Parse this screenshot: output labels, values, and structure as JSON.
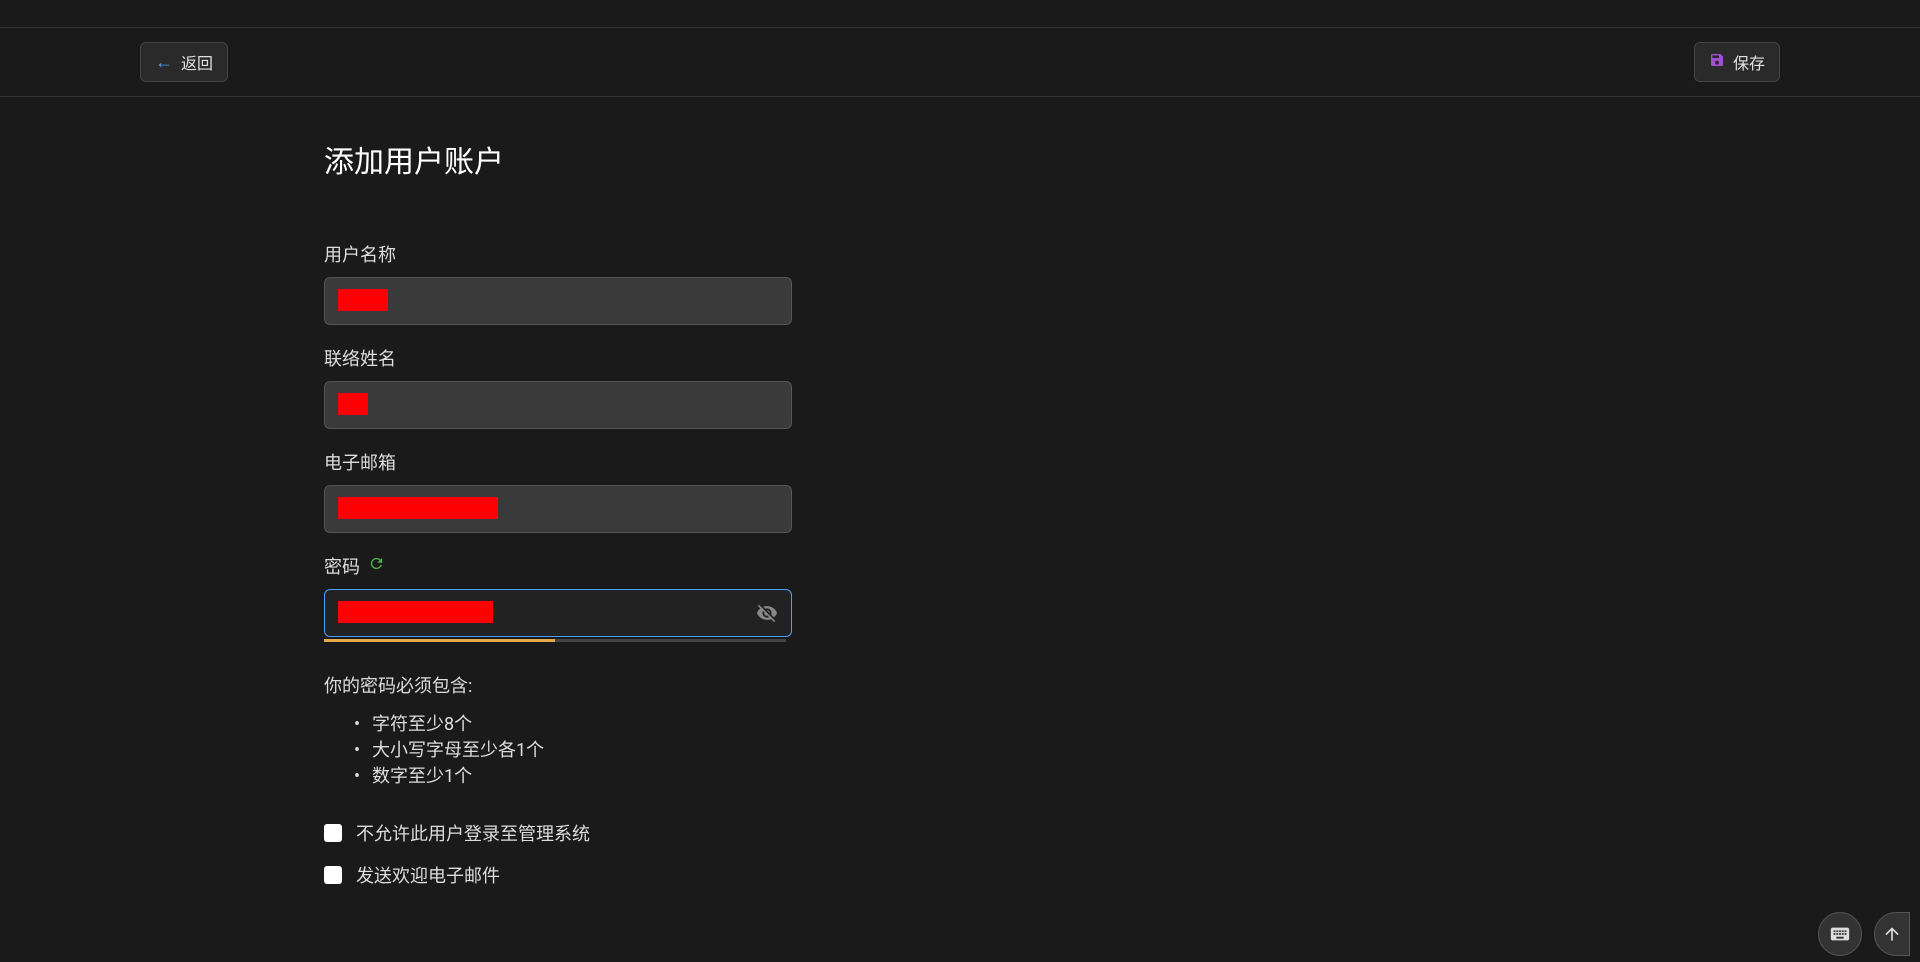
{
  "header": {
    "back_label": "返回",
    "save_label": "保存"
  },
  "page": {
    "title": "添加用户账户"
  },
  "form": {
    "username": {
      "label": "用户名称",
      "value": ""
    },
    "contact_name": {
      "label": "联络姓名",
      "value": ""
    },
    "email": {
      "label": "电子邮箱",
      "value": ""
    },
    "password": {
      "label": "密码",
      "value": "",
      "strength_percent": 50
    }
  },
  "password_requirements": {
    "title": "你的密码必须包含:",
    "items": [
      "字符至少8个",
      "大小写字母至少各1个",
      "数字至少1个"
    ]
  },
  "checkboxes": {
    "disallow_login": {
      "label": "不允许此用户登录至管理系统",
      "checked": false
    },
    "send_welcome": {
      "label": "发送欢迎电子邮件",
      "checked": false
    }
  }
}
